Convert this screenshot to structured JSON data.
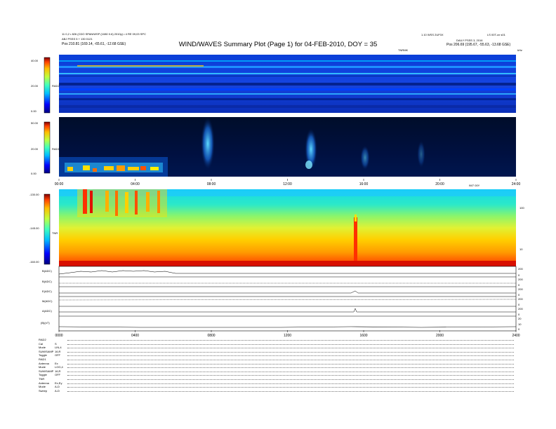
{
  "header": {
    "title": "WIND/WAVES Summary Plot (Page 1) for 04-FEB-2010, DOY = 35",
    "left_line1": "11 0,2 • 826 (CDO SPAN/WSP (1080 0.6) 2010y) • 4 RE 09,03 SPC",
    "left_line2": "ABJ PSSS 5 + 130 0121",
    "left_pos": "Pos    210.81 (169.14, -65.61, -12.68 GSE)",
    "right_line1": "1.10 WSS 2UF0X",
    "right_line1b": "LS 00T-cn s01",
    "right_line2": "DAILY PSSS 3, 2016",
    "right_pos": "Pos    206.69 (195.67, -55.63, -13.68 GSE)",
    "tnr_label": "TNRMK",
    "khz_label": "kHz"
  },
  "panels": {
    "rad2": {
      "label": "RAD2",
      "ticks": [
        "40.00",
        "20.00",
        "0.00"
      ]
    },
    "rad1": {
      "label": "RAD1",
      "ticks": [
        "50.00",
        "20.00",
        "0.00"
      ]
    },
    "tnr": {
      "label": "TNR",
      "ticks": [
        "-130.00",
        "-145.00",
        "-160.00"
      ],
      "right_ticks": [
        "100",
        "10"
      ]
    }
  },
  "time_axis": {
    "upper": [
      "00:00",
      "04:00",
      "08:00",
      "12:00",
      "16:00",
      "20:00",
      "24:00"
    ],
    "upper_right_label": "IW7 00Y",
    "lower": [
      "0000",
      "0400",
      "0800",
      "1200",
      "1600",
      "2000",
      "2400"
    ]
  },
  "line_panels": [
    {
      "label": "B(ADC)",
      "right": [
        "200",
        "0"
      ]
    },
    {
      "label": "B(ADC)",
      "right": [
        "200",
        "0"
      ]
    },
    {
      "label": "E(ADC)",
      "right": [
        "200",
        "0"
      ]
    },
    {
      "label": "M(ADC)",
      "right": [
        "200",
        "0"
      ]
    },
    {
      "label": "A(ADC)",
      "right": [
        "200",
        "0"
      ]
    },
    {
      "label": "(B)(nT)",
      "right": [
        "20",
        "10",
        "0"
      ]
    }
  ],
  "footer": {
    "rows": [
      {
        "k": "RAD2",
        "v": ""
      },
      {
        "k": "Cal",
        "v": "S"
      },
      {
        "k": "Mode",
        "v": "LIN,4"
      },
      {
        "k": "SUM/SAMP",
        "v": "16,R"
      },
      {
        "k": "Toggle",
        "v": "OFF"
      },
      {
        "k": "RAD1",
        "v": ""
      },
      {
        "k": "Antenna",
        "v": "Ex"
      },
      {
        "k": "Mode",
        "v": "LOG,4"
      },
      {
        "k": "SUM/SAMP",
        "v": "16,R"
      },
      {
        "k": "Toggle",
        "v": "OFF"
      },
      {
        "k": "TNR",
        "v": ""
      },
      {
        "k": "Antenna",
        "v": "Ex,Ey"
      },
      {
        "k": "Mode",
        "v": "A-D"
      },
      {
        "k": "Sweep",
        "v": "A-D"
      }
    ]
  },
  "chart_data": [
    {
      "type": "heatmap",
      "panel": "RAD2",
      "ylabel": "RAD2",
      "ylim": [
        0,
        40
      ],
      "colorbar": "jet",
      "x_range_hours": [
        0,
        24
      ]
    },
    {
      "type": "heatmap",
      "panel": "RAD1",
      "ylabel": "RAD1",
      "ylim": [
        0,
        50
      ],
      "colorbar": "jet",
      "x_range_hours": [
        0,
        24
      ],
      "features": [
        {
          "type": "type III burst",
          "time_hours": 7.8
        },
        {
          "type": "type III burst",
          "time_hours": 13.7
        },
        {
          "type": "activity band",
          "time_hours": [
            0,
            5.5
          ]
        }
      ]
    },
    {
      "type": "heatmap",
      "panel": "TNR",
      "ylabel": "TNR",
      "ylim": [
        -160,
        -130
      ],
      "colorbar": "jet",
      "x_range_hours": [
        0,
        24
      ],
      "features": [
        {
          "type": "spike",
          "time_hours": 15.8
        },
        {
          "type": "high activity",
          "time_hours": [
            1,
            5.5
          ]
        }
      ]
    },
    {
      "type": "line",
      "panel": "line-panels",
      "x_range_hours": [
        0,
        24
      ]
    }
  ]
}
